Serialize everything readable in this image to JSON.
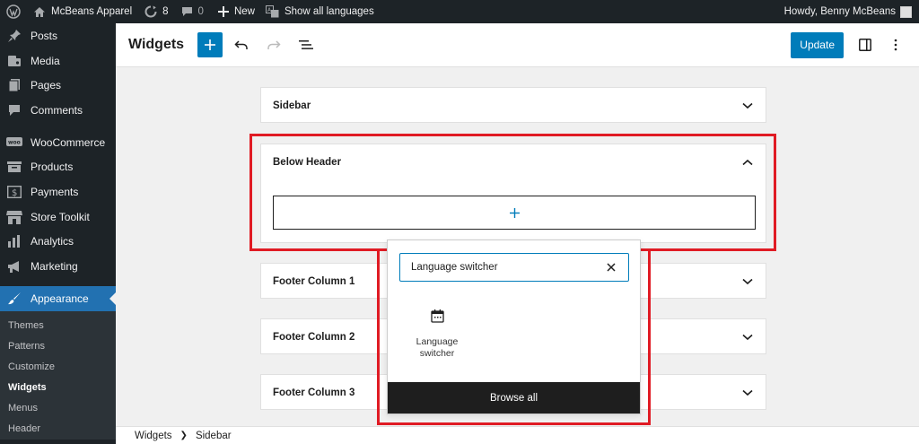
{
  "adminbar": {
    "site_name": "McBeans Apparel",
    "updates_count": "8",
    "comments_count": "0",
    "new_label": "New",
    "languages_label": "Show all languages",
    "greeting": "Howdy, Benny McBeans"
  },
  "sidebar": {
    "items": [
      {
        "label": "Posts",
        "icon": "pin-icon"
      },
      {
        "label": "Media",
        "icon": "media-icon"
      },
      {
        "label": "Pages",
        "icon": "pages-icon"
      },
      {
        "label": "Comments",
        "icon": "comment-icon"
      },
      {
        "label": "WooCommerce",
        "icon": "woo-icon"
      },
      {
        "label": "Products",
        "icon": "products-icon"
      },
      {
        "label": "Payments",
        "icon": "payments-icon"
      },
      {
        "label": "Store Toolkit",
        "icon": "store-icon"
      },
      {
        "label": "Analytics",
        "icon": "analytics-icon"
      },
      {
        "label": "Marketing",
        "icon": "megaphone-icon"
      },
      {
        "label": "Appearance",
        "icon": "brush-icon"
      }
    ],
    "submenu": [
      "Themes",
      "Patterns",
      "Customize",
      "Widgets",
      "Menus",
      "Header"
    ]
  },
  "header": {
    "title": "Widgets",
    "update_label": "Update"
  },
  "widget_areas": [
    {
      "title": "Sidebar"
    },
    {
      "title": "Below Header"
    },
    {
      "title": "Footer Column 1"
    },
    {
      "title": "Footer Column 2"
    },
    {
      "title": "Footer Column 3"
    }
  ],
  "inserter": {
    "search_value": "Language switcher",
    "result_label": "Language switcher",
    "browse_all": "Browse all"
  },
  "breadcrumb": {
    "root": "Widgets",
    "current": "Sidebar"
  },
  "colors": {
    "accent": "#007cba",
    "highlight": "#e01b24",
    "admin_dark": "#1d2327"
  }
}
